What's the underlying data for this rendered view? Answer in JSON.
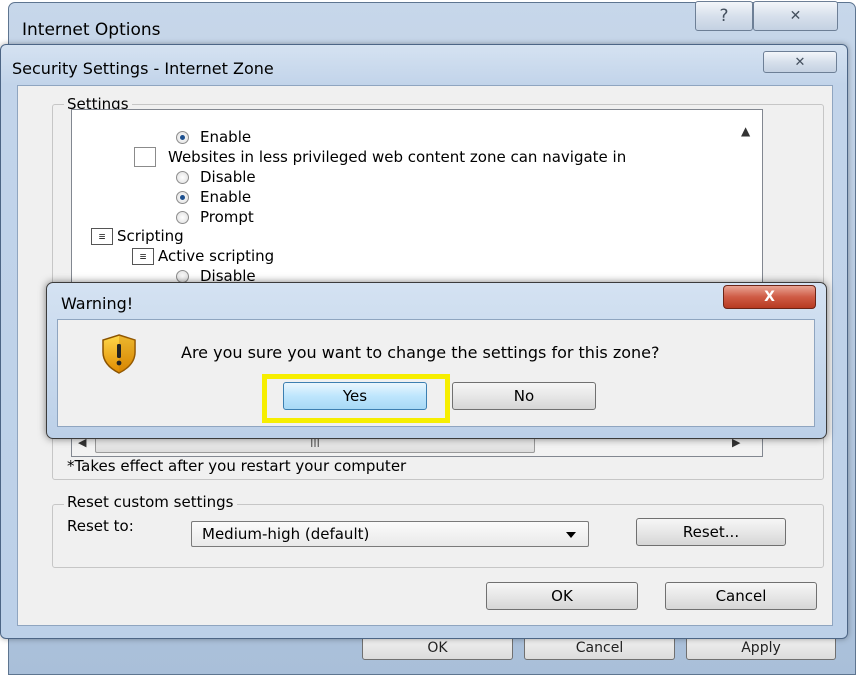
{
  "internet_options": {
    "title": "Internet Options",
    "help_glyph": "?",
    "close_glyph": "✕",
    "bottom_buttons": [
      "OK",
      "Cancel",
      "Apply"
    ]
  },
  "security_settings": {
    "title": "Security Settings - Internet Zone",
    "close_glyph": "✕",
    "settings_group_label": "Settings",
    "tree": [
      {
        "kind": "radio",
        "checked": true,
        "label": "Enable"
      },
      {
        "kind": "doc",
        "label": "Websites in less privileged web content zone can navigate in"
      },
      {
        "kind": "radio",
        "checked": false,
        "label": "Disable"
      },
      {
        "kind": "radio",
        "checked": true,
        "label": "Enable"
      },
      {
        "kind": "radio",
        "checked": false,
        "label": "Prompt"
      },
      {
        "kind": "script",
        "label": "Scripting"
      },
      {
        "kind": "script",
        "label": "Active scripting"
      },
      {
        "kind": "radio",
        "checked": false,
        "label": "Disable"
      }
    ],
    "hscroll_thumb_grip": "III",
    "restart_note": "*Takes effect after you restart your computer",
    "reset_group_label": "Reset custom settings",
    "reset_to_label": "Reset to:",
    "reset_to_value": "Medium-high (default)",
    "reset_button": "Reset...",
    "ok_button": "OK",
    "cancel_button": "Cancel"
  },
  "warning": {
    "title": "Warning!",
    "close_glyph": "X",
    "message": "Are you sure you want to change the settings for this zone?",
    "yes_button": "Yes",
    "no_button": "No",
    "highlight_color": "#f6ee00",
    "icon": "shield-warning-icon"
  }
}
